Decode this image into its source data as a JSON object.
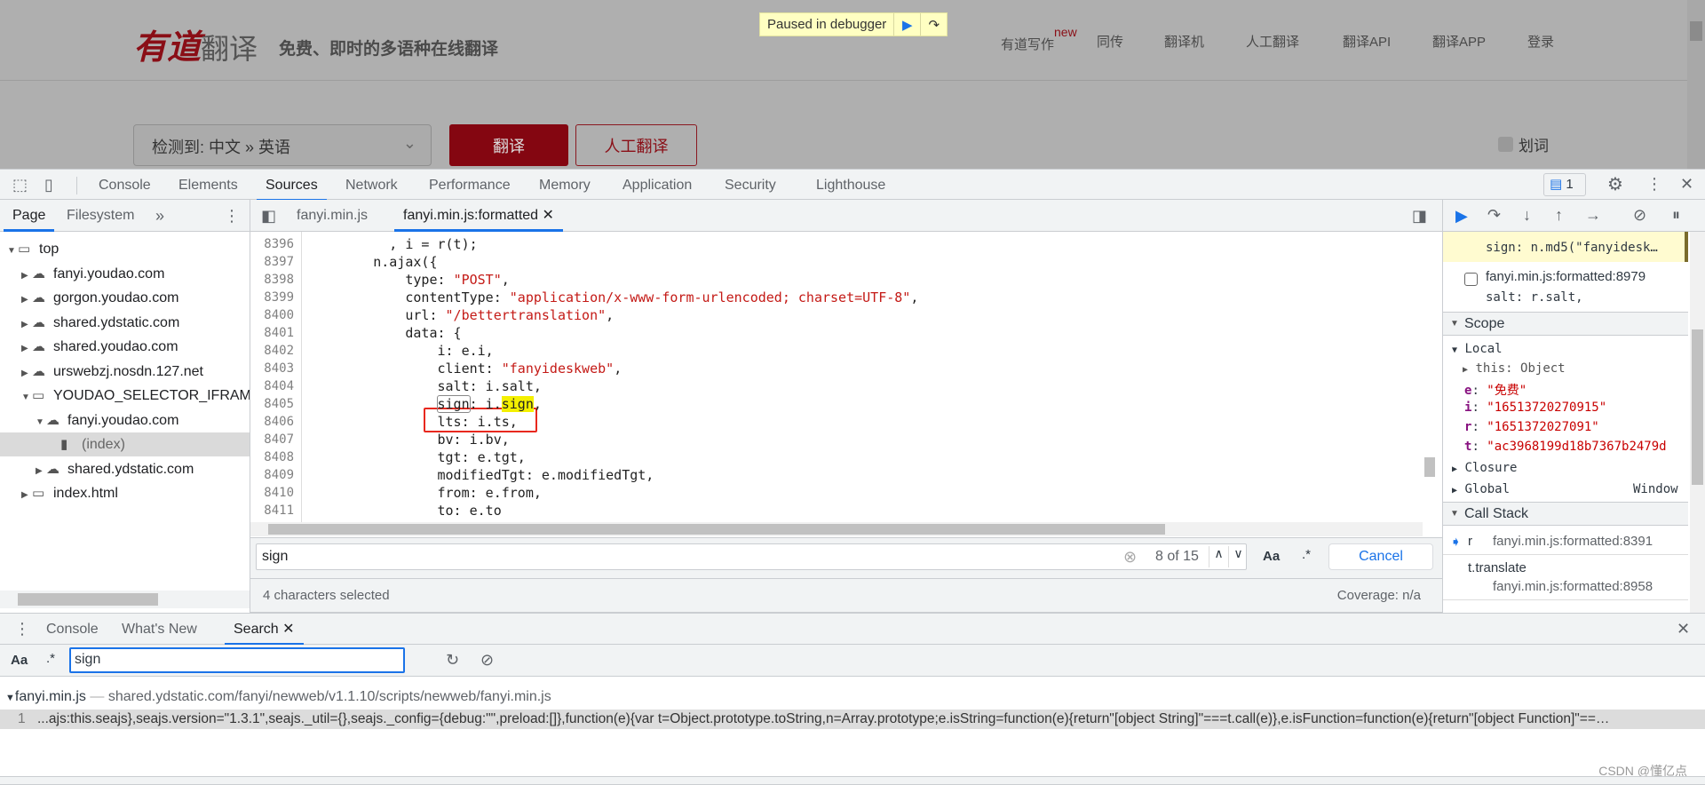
{
  "webpage": {
    "logo": {
      "brand_red": "有道",
      "brand_grey": "翻译"
    },
    "slogan": "免费、即时的多语种在线翻译",
    "debugger_banner": {
      "text": "Paused in debugger"
    },
    "nav": [
      {
        "label": "有道写作",
        "badge": "new"
      },
      {
        "label": "同传"
      },
      {
        "label": "翻译机"
      },
      {
        "label": "人工翻译"
      },
      {
        "label": "翻译API"
      },
      {
        "label": "翻译APP"
      },
      {
        "label": "登录"
      }
    ],
    "language_select": "检测到: 中文 » 英语",
    "translate_button": "翻译",
    "human_translate_button": "人工翻译",
    "word_select_label": "划词"
  },
  "devtools": {
    "tabs": [
      "Console",
      "Elements",
      "Sources",
      "Network",
      "Performance",
      "Memory",
      "Application",
      "Security",
      "Lighthouse"
    ],
    "active_tab": "Sources",
    "issues_count": "1",
    "navigator": {
      "tabs": [
        "Page",
        "Filesystem"
      ],
      "tree": [
        {
          "label": "top",
          "icon": "frame",
          "expanded": true
        },
        {
          "label": "fanyi.youdao.com",
          "icon": "cloud"
        },
        {
          "label": "gorgon.youdao.com",
          "icon": "cloud"
        },
        {
          "label": "shared.ydstatic.com",
          "icon": "cloud"
        },
        {
          "label": "shared.youdao.com",
          "icon": "cloud"
        },
        {
          "label": "urswebzj.nosdn.127.net",
          "icon": "cloud"
        },
        {
          "label": "YOUDAO_SELECTOR_IFRAME",
          "icon": "frame",
          "expanded": true
        },
        {
          "label": "fanyi.youdao.com",
          "icon": "cloud",
          "expanded": true
        },
        {
          "label": "(index)",
          "icon": "file",
          "selected": true
        },
        {
          "label": "shared.ydstatic.com",
          "icon": "cloud"
        },
        {
          "label": "index.html",
          "icon": "frame"
        }
      ]
    },
    "editor": {
      "tabs": [
        {
          "label": "fanyi.min.js"
        },
        {
          "label": "fanyi.min.js:formatted",
          "active": true
        }
      ],
      "lines": [
        {
          "n": "8396",
          "code": "          , i = r(t);"
        },
        {
          "n": "8397",
          "code": "        n.ajax({"
        },
        {
          "n": "8398",
          "code": "            type: \"POST\","
        },
        {
          "n": "8399",
          "code": "            contentType: \"application/x-www-form-urlencoded; charset=UTF-8\","
        },
        {
          "n": "8400",
          "code": "            url: \"/bettertranslation\","
        },
        {
          "n": "8401",
          "code": "            data: {"
        },
        {
          "n": "8402",
          "code": "                i: e.i,"
        },
        {
          "n": "8403",
          "code": "                client: \"fanyideskweb\","
        },
        {
          "n": "8404",
          "code": "                salt: i.salt,"
        },
        {
          "n": "8405",
          "code": "                sign: i.sign,"
        },
        {
          "n": "8406",
          "code": "                lts: i.ts,"
        },
        {
          "n": "8407",
          "code": "                bv: i.bv,"
        },
        {
          "n": "8408",
          "code": "                tgt: e.tgt,"
        },
        {
          "n": "8409",
          "code": "                modifiedTgt: e.modifiedTgt,"
        },
        {
          "n": "8410",
          "code": "                from: e.from,"
        },
        {
          "n": "8411",
          "code": "                to: e.to"
        }
      ],
      "find": {
        "query": "sign",
        "match_count": "8 of 15",
        "case_label": "Aa",
        "regex_label": ".*",
        "cancel_label": "Cancel"
      },
      "status": "4 characters selected",
      "coverage": "Coverage: n/a"
    },
    "debugger": {
      "breakpoints": [
        {
          "code": "sign: n.md5(\"fanyidesk…",
          "active": true
        },
        {
          "location": "fanyi.min.js:formatted:8979",
          "code": "salt: r.salt,"
        }
      ],
      "scope_title": "Scope",
      "local_title": "Local",
      "this_label": "this: Object",
      "locals": [
        {
          "name": "e",
          "value": "\"免费\""
        },
        {
          "name": "i",
          "value": "\"16513720270915\""
        },
        {
          "name": "r",
          "value": "\"1651372027091\""
        },
        {
          "name": "t",
          "value": "\"ac3968199d18b7367b2479d"
        }
      ],
      "closure_label": "Closure",
      "global_label": "Global",
      "global_value": "Window",
      "callstack_title": "Call Stack",
      "frames": [
        {
          "fn": "r",
          "location": "fanyi.min.js:formatted:8391",
          "current": true
        },
        {
          "fn": "t.translate",
          "location": "fanyi.min.js:formatted:8958"
        }
      ]
    },
    "drawer": {
      "tabs": [
        "Console",
        "What's New",
        "Search"
      ],
      "active_tab": "Search",
      "case_label": "Aa",
      "regex_label": ".*",
      "query": "sign",
      "result_file": "fanyi.min.js",
      "result_path": "shared.ydstatic.com/fanyi/newweb/v1.1.10/scripts/newweb/fanyi.min.js",
      "result_line": "1",
      "result_text": "...ajs:this.seajs},seajs.version=\"1.3.1\",seajs._util={},seajs._config={debug:\"\",preload:[]},function(e){var t=Object.prototype.toString,n=Array.prototype;e.isString=function(e){return\"[object String]\"===t.call(e)},e.isFunction=function(e){return\"[object Function]\"==…"
    }
  },
  "watermark": "CSDN @懂亿点",
  "colors": {
    "accent": "#1a73e8",
    "youdao_red": "#840611",
    "highlight": "#f4f000",
    "annotation_box": "#e8281e"
  }
}
